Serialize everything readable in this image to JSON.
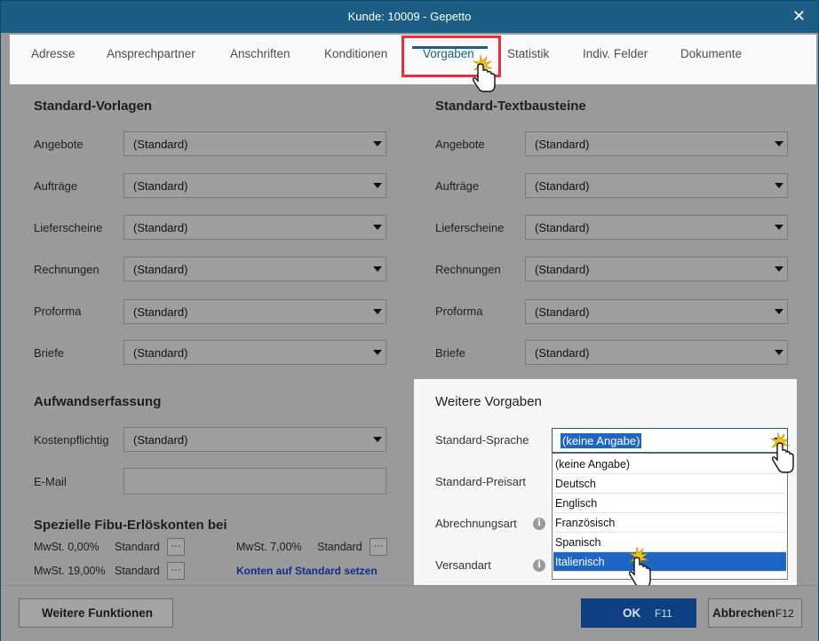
{
  "window": {
    "title": "Kunde: 10009 - Gepetto",
    "close_glyph": "✕"
  },
  "tabs": [
    {
      "label": "Adresse"
    },
    {
      "label": "Ansprechpartner"
    },
    {
      "label": "Anschriften"
    },
    {
      "label": "Konditionen"
    },
    {
      "label": "Vorgaben"
    },
    {
      "label": "Statistik"
    },
    {
      "label": "Indiv. Felder"
    },
    {
      "label": "Dokumente"
    }
  ],
  "standard_vorlagen": {
    "title": "Standard-Vorlagen",
    "rows": [
      {
        "label": "Angebote",
        "value": "(Standard)"
      },
      {
        "label": "Aufträge",
        "value": "(Standard)"
      },
      {
        "label": "Lieferscheine",
        "value": "(Standard)"
      },
      {
        "label": "Rechnungen",
        "value": "(Standard)"
      },
      {
        "label": "Proforma",
        "value": "(Standard)"
      },
      {
        "label": "Briefe",
        "value": "(Standard)"
      }
    ]
  },
  "standard_textbausteine": {
    "title": "Standard-Textbausteine",
    "rows": [
      {
        "label": "Angebote",
        "value": "(Standard)"
      },
      {
        "label": "Aufträge",
        "value": "(Standard)"
      },
      {
        "label": "Lieferscheine",
        "value": "(Standard)"
      },
      {
        "label": "Rechnungen",
        "value": "(Standard)"
      },
      {
        "label": "Proforma",
        "value": "(Standard)"
      },
      {
        "label": "Briefe",
        "value": "(Standard)"
      }
    ]
  },
  "aufwand": {
    "title": "Aufwandserfassung",
    "kosten_label": "Kostenpflichtig",
    "kosten_value": "(Standard)",
    "email_label": "E-Mail",
    "email_value": ""
  },
  "fibu": {
    "title": "Spezielle Fibu-Erlöskonten bei",
    "items": [
      {
        "label": "MwSt. 0,00%",
        "value": "Standard"
      },
      {
        "label": "MwSt. 7,00%",
        "value": "Standard"
      },
      {
        "label": "MwSt. 19,00%",
        "value": "Standard"
      }
    ],
    "dots": "···",
    "reset_link": "Konten auf Standard setzen"
  },
  "weitere": {
    "title": "Weitere Vorgaben",
    "sprache_label": "Standard-Sprache",
    "sprache_value": "(keine Angabe)",
    "preisart_label": "Standard-Preisart",
    "abrechnung_label": "Abrechnungsart",
    "versand_label": "Versandart",
    "info_glyph": "i",
    "options": [
      "(keine Angabe)",
      "Deutsch",
      "Englisch",
      "Französisch",
      "Spanisch",
      "Italienisch"
    ]
  },
  "footer": {
    "weitere_funktionen": "Weitere Funktionen",
    "ok": "OK",
    "ok_key": "F11",
    "abbrechen": "Abbrechen",
    "abbrechen_key": "F12"
  },
  "colors": {
    "titlebar": "#1b5d84",
    "highlight": "#e8303c",
    "selection": "#1f66c4"
  }
}
